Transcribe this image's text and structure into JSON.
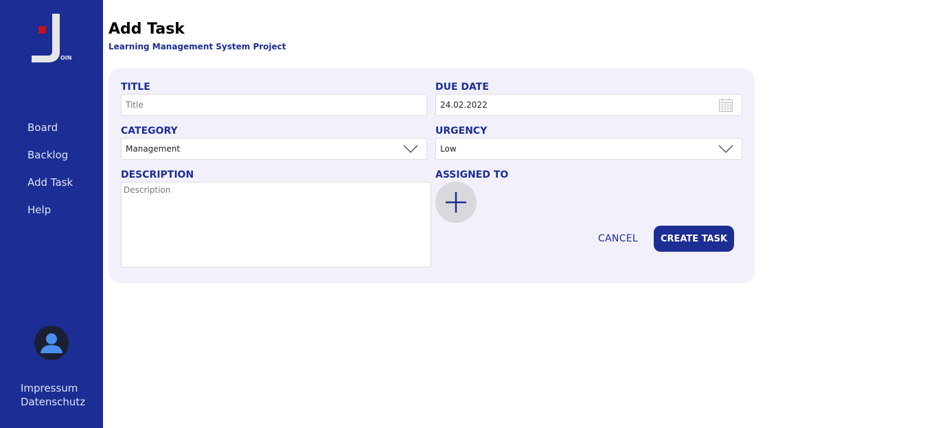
{
  "sidebar": {
    "logo_text": "OIN",
    "nav": [
      {
        "label": "Board"
      },
      {
        "label": "Backlog"
      },
      {
        "label": "Add Task"
      },
      {
        "label": "Help"
      }
    ],
    "footer": {
      "impressum": "Impressum",
      "datenschutz": "Datenschutz"
    }
  },
  "header": {
    "title": "Add Task",
    "subtitle": "Learning Management System Project"
  },
  "form": {
    "title": {
      "label": "TITLE",
      "value": "",
      "placeholder": "Title"
    },
    "due_date": {
      "label": "DUE DATE",
      "value": "24.02.2022",
      "icon": "calendar-icon"
    },
    "category": {
      "label": "CATEGORY",
      "value": "Management",
      "icon": "chevron-down-icon"
    },
    "urgency": {
      "label": "URGENCY",
      "value": "Low",
      "icon": "chevron-down-icon"
    },
    "description": {
      "label": "DESCRIPTION",
      "value": "",
      "placeholder": "Description"
    },
    "assigned_to": {
      "label": "ASSIGNED TO",
      "icon": "plus-icon"
    },
    "cancel_label": "CANCEL",
    "create_label": "CREATE TASK"
  },
  "colors": {
    "brand": "#1c2d93",
    "card": "#f2f1fb",
    "logo_red": "#c1121f",
    "logo_gray": "#e6e6ea"
  }
}
